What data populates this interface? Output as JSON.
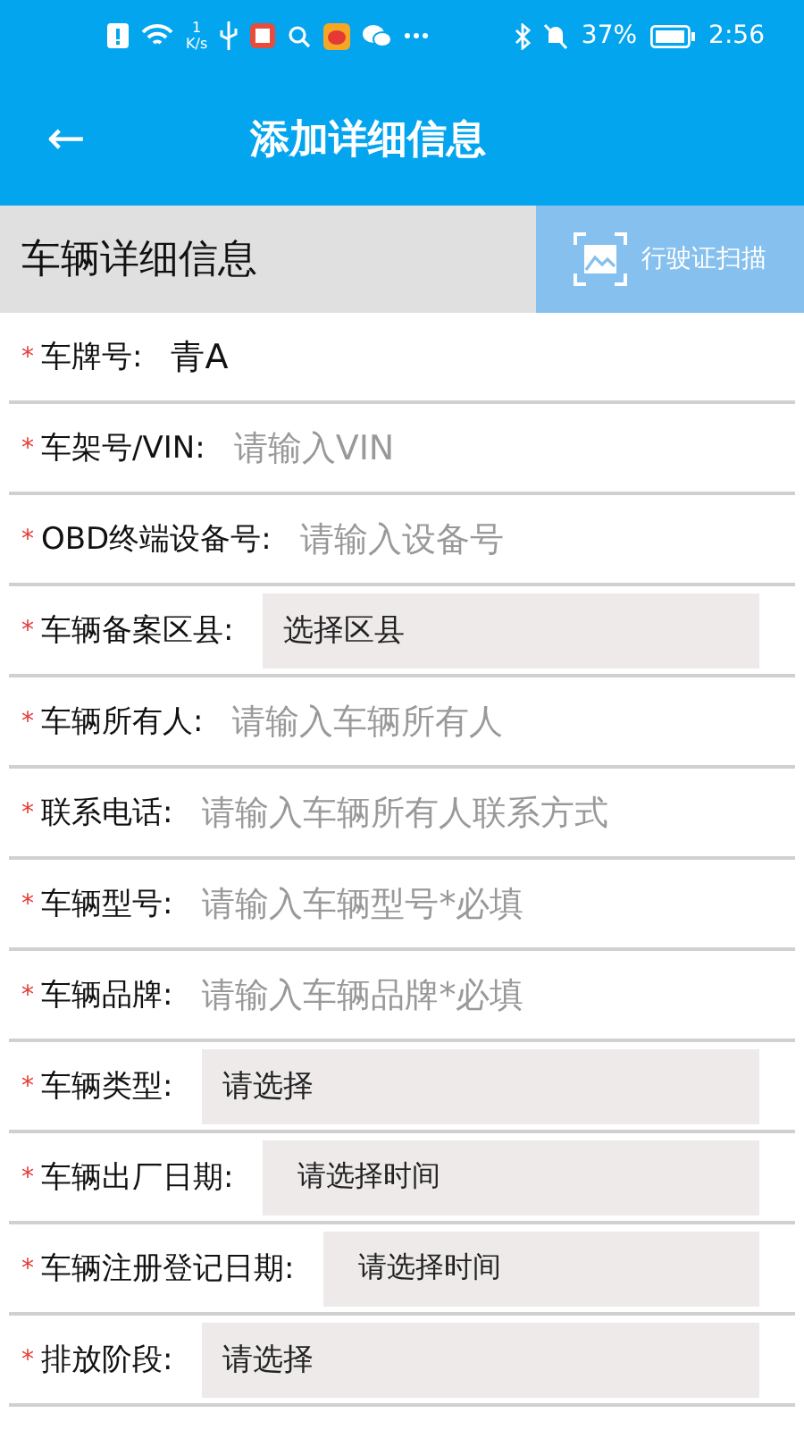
{
  "status_bar": {
    "speed_value": "1",
    "speed_unit": "K/s",
    "battery": "37%",
    "time": "2:56"
  },
  "header": {
    "back": "←",
    "title": "添加详细信息"
  },
  "section": {
    "title": "车辆详细信息",
    "scan_button": "行驶证扫描"
  },
  "fields": [
    {
      "kind": "input",
      "star": "*",
      "label": "车牌号:",
      "value": "青A"
    },
    {
      "kind": "input",
      "star": "*",
      "label": "车架号/VIN:",
      "placeholder": "请输入VIN"
    },
    {
      "kind": "input",
      "star": "*",
      "label": "OBD终端设备号:",
      "placeholder": "请输入设备号"
    },
    {
      "kind": "select",
      "star": "*",
      "label": "车辆备案区县:",
      "value": "选择区县"
    },
    {
      "kind": "input",
      "star": "*",
      "label": "车辆所有人:",
      "placeholder": "请输入车辆所有人"
    },
    {
      "kind": "input",
      "star": "*",
      "label": "联系电话:",
      "placeholder": "请输入车辆所有人联系方式"
    },
    {
      "kind": "input",
      "star": "*",
      "label": "车辆型号:",
      "placeholder": "请输入车辆型号*必填"
    },
    {
      "kind": "input",
      "star": "*",
      "label": "车辆品牌:",
      "placeholder": "请输入车辆品牌*必填"
    },
    {
      "kind": "select",
      "star": "*",
      "label": "车辆类型:",
      "value": "请选择"
    },
    {
      "kind": "date",
      "star": "*",
      "label": "车辆出厂日期:",
      "value": "请选择时间"
    },
    {
      "kind": "date",
      "star": "*",
      "label": "车辆注册登记日期:",
      "value": "请选择时间"
    },
    {
      "kind": "select",
      "star": "*",
      "label": "排放阶段:",
      "value": "请选择"
    }
  ]
}
